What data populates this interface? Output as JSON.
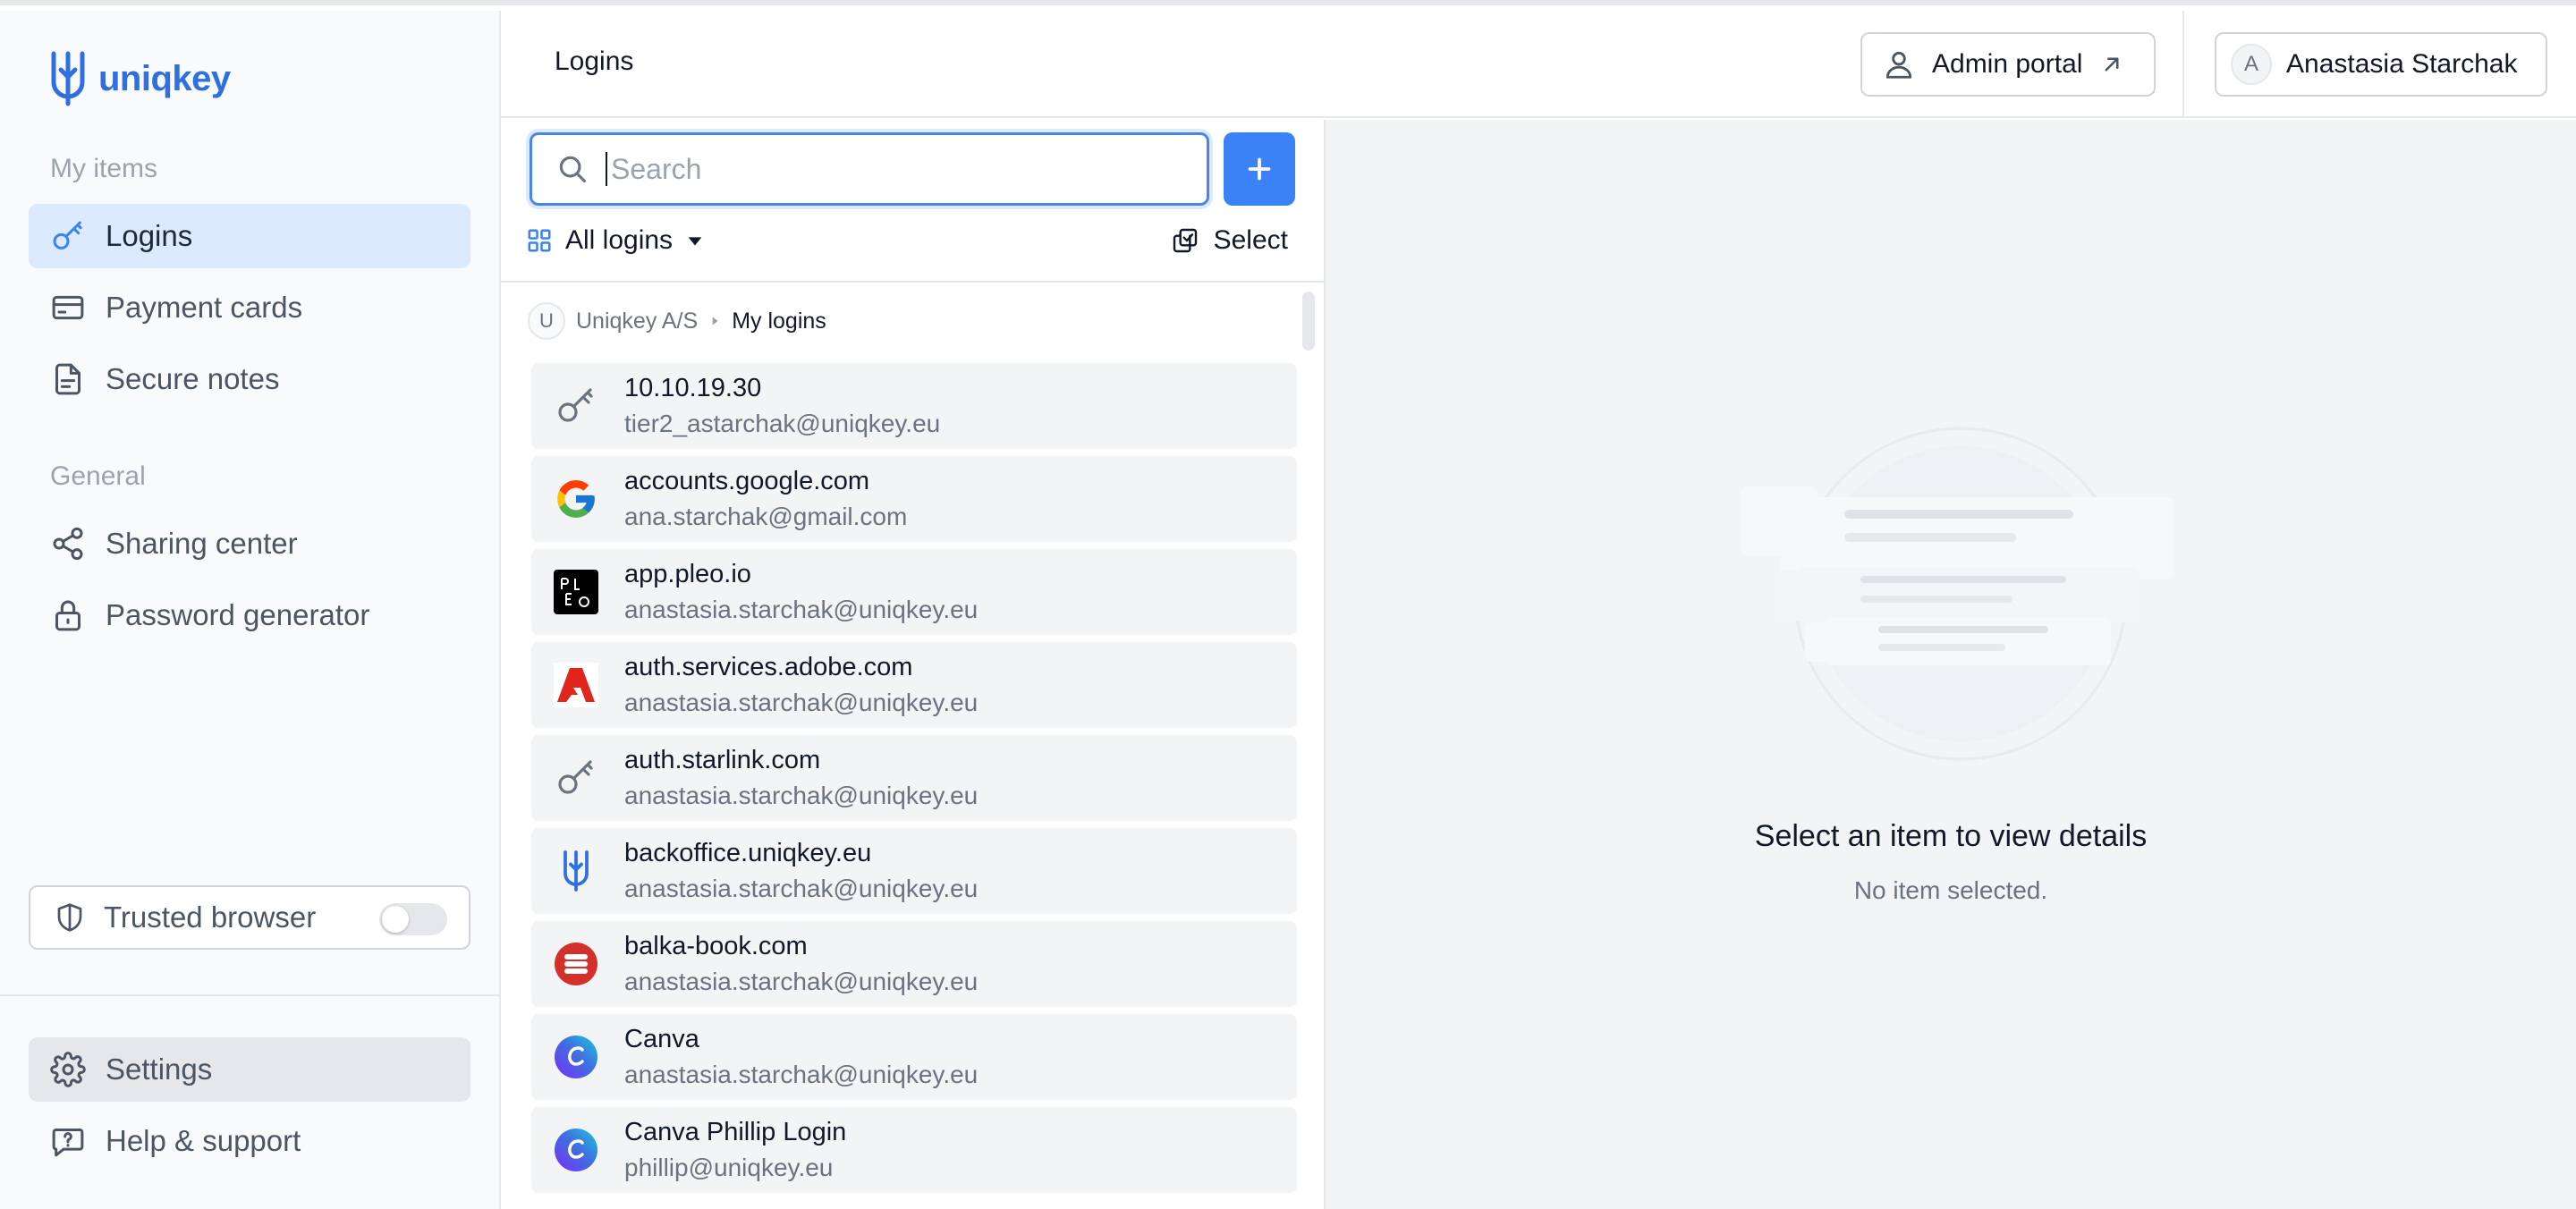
{
  "brand": {
    "name": "uniqkey"
  },
  "sidebar": {
    "my_items_label": "My items",
    "general_label": "General",
    "items": [
      {
        "label": "Logins",
        "icon": "key-icon",
        "active": true
      },
      {
        "label": "Payment cards",
        "icon": "credit-card-icon"
      },
      {
        "label": "Secure notes",
        "icon": "note-icon"
      },
      {
        "label": "Sharing center",
        "icon": "share-icon"
      },
      {
        "label": "Password generator",
        "icon": "lock-icon"
      }
    ],
    "trusted_browser": {
      "label": "Trusted browser",
      "enabled": false
    },
    "settings_label": "Settings",
    "help_label": "Help & support"
  },
  "header": {
    "title": "Logins",
    "admin_portal_label": "Admin portal",
    "user": {
      "initial": "A",
      "name": "Anastasia Starchak"
    }
  },
  "list": {
    "search_placeholder": "Search",
    "filter_label": "All logins",
    "select_label": "Select",
    "breadcrumb": {
      "initial": "U",
      "org": "Uniqkey A/S",
      "current": "My logins"
    },
    "rows": [
      {
        "title": "10.10.19.30",
        "subtitle": "tier2_astarchak@uniqkey.eu",
        "icon": "key-icon"
      },
      {
        "title": "accounts.google.com",
        "subtitle": "ana.starchak@gmail.com",
        "icon": "google-icon"
      },
      {
        "title": "app.pleo.io",
        "subtitle": "anastasia.starchak@uniqkey.eu",
        "icon": "pleo-icon"
      },
      {
        "title": "auth.services.adobe.com",
        "subtitle": "anastasia.starchak@uniqkey.eu",
        "icon": "adobe-icon"
      },
      {
        "title": "auth.starlink.com",
        "subtitle": "anastasia.starchak@uniqkey.eu",
        "icon": "key-icon"
      },
      {
        "title": "backoffice.uniqkey.eu",
        "subtitle": "anastasia.starchak@uniqkey.eu",
        "icon": "uniqkey-icon"
      },
      {
        "title": "balka-book.com",
        "subtitle": "anastasia.starchak@uniqkey.eu",
        "icon": "balka-book-icon"
      },
      {
        "title": "Canva",
        "subtitle": "anastasia.starchak@uniqkey.eu",
        "icon": "canva-icon"
      },
      {
        "title": "Canva Phillip Login",
        "subtitle": "phillip@uniqkey.eu",
        "icon": "canva-icon"
      }
    ]
  },
  "detail": {
    "title": "Select an item to view details",
    "subtitle": "No item selected."
  },
  "colors": {
    "accent": "#3b82f6",
    "brand": "#2f6fe0",
    "active_nav_bg": "#dbeafe"
  }
}
